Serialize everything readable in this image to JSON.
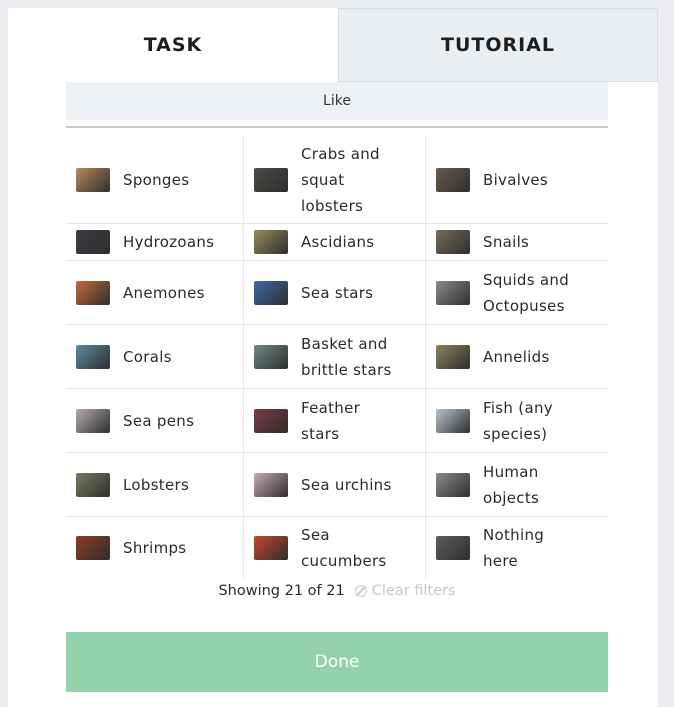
{
  "tabs": [
    {
      "label": "TASK"
    },
    {
      "label": "TUTORIAL"
    }
  ],
  "like_label": "Like",
  "choices": [
    {
      "label": "Sponges",
      "icon": "sponges-thumbnail",
      "color": "#b98a5e"
    },
    {
      "label": "Crabs and squat lobsters",
      "icon": "crabs-thumbnail",
      "color": "#4a4a44"
    },
    {
      "label": "Bivalves",
      "icon": "bivalves-thumbnail",
      "color": "#6b5a4a"
    },
    {
      "label": "Hydrozoans",
      "icon": "hydrozoans-thumbnail",
      "color": "#3a3d44"
    },
    {
      "label": "Ascidians",
      "icon": "ascidians-thumbnail",
      "color": "#9a8a5a"
    },
    {
      "label": "Snails",
      "icon": "snails-thumbnail",
      "color": "#7a6a58"
    },
    {
      "label": "Anemones",
      "icon": "anemones-thumbnail",
      "color": "#c46a3a"
    },
    {
      "label": "Sea stars",
      "icon": "sea-stars-thumbnail",
      "color": "#3f67a8"
    },
    {
      "label": "Squids and Octopuses",
      "icon": "squids-thumbnail",
      "color": "#8a8a86"
    },
    {
      "label": "Corals",
      "icon": "corals-thumbnail",
      "color": "#5e8aa0"
    },
    {
      "label": "Basket and brittle stars",
      "icon": "brittle-stars-thumbnail",
      "color": "#6e8a86"
    },
    {
      "label": "Annelids",
      "icon": "annelids-thumbnail",
      "color": "#8a8458"
    },
    {
      "label": "Sea pens",
      "icon": "sea-pens-thumbnail",
      "color": "#b4aab0"
    },
    {
      "label": "Feather stars",
      "icon": "feather-stars-thumbnail",
      "color": "#7a3a44"
    },
    {
      "label": "Fish (any species)",
      "icon": "fish-thumbnail",
      "color": "#b9c4cc"
    },
    {
      "label": "Lobsters",
      "icon": "lobsters-thumbnail",
      "color": "#7a7a62"
    },
    {
      "label": "Sea urchins",
      "icon": "sea-urchins-thumbnail",
      "color": "#c9a8b4"
    },
    {
      "label": "Human objects",
      "icon": "human-objects-thumbnail",
      "color": "#8a8a8a"
    },
    {
      "label": "Shrimps",
      "icon": "shrimps-thumbnail",
      "color": "#8a3a24"
    },
    {
      "label": "Sea cucumbers",
      "icon": "sea-cucumbers-thumbnail",
      "color": "#c4482c"
    },
    {
      "label": "Nothing here",
      "icon": "nothing-here-thumbnail",
      "color": "#5c5e58"
    }
  ],
  "showing_text": "Showing 21 of 21",
  "clear_filters_label": "Clear filters",
  "done_label": "Done",
  "colors": {
    "done_button": "#94d1ad",
    "tab_inactive": "#eceff2",
    "like_bar": "#eef1f4"
  }
}
